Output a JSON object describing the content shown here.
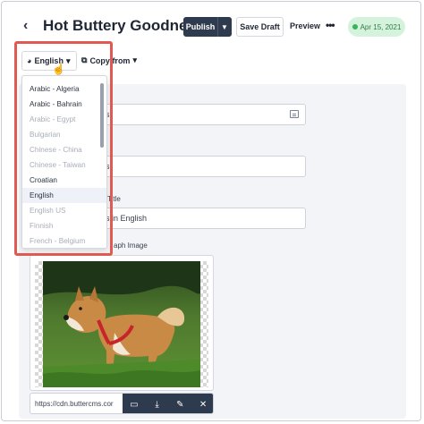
{
  "header": {
    "back_icon": "chevron-left-icon",
    "title": "Hot Buttery Goodness",
    "publish_label": "Publish",
    "save_draft_label": "Save Draft",
    "preview_label": "Preview",
    "more_label": "•••",
    "date_badge": "Apr 15, 2021"
  },
  "locale": {
    "current": "English",
    "copy_from_label": "Copy from",
    "languages": [
      "Arabic - Algeria",
      "Arabic - Bahrain",
      "Arabic - Egypt",
      "Bulgarian",
      "Chinese - China",
      "Chinese - Taiwan",
      "Croatian",
      "English",
      "English US",
      "Finnish",
      "French - Belgium"
    ],
    "selected_index": 7
  },
  "fields": {
    "field1_value_fragment": "s",
    "field2_value_fragment": "s",
    "title_label_fragment": "Title",
    "title_value_fragment": "s in English",
    "image_label_fragment": "aph Image"
  },
  "image": {
    "url_value": "https://cdn.buttercms.cor",
    "alt": "Shiba Inu dog standing in grass"
  },
  "colors": {
    "dark_button": "#2e3a4e",
    "highlight_border": "#e05a52",
    "badge_bg": "#d5f3dc",
    "badge_dot": "#39b35c"
  }
}
